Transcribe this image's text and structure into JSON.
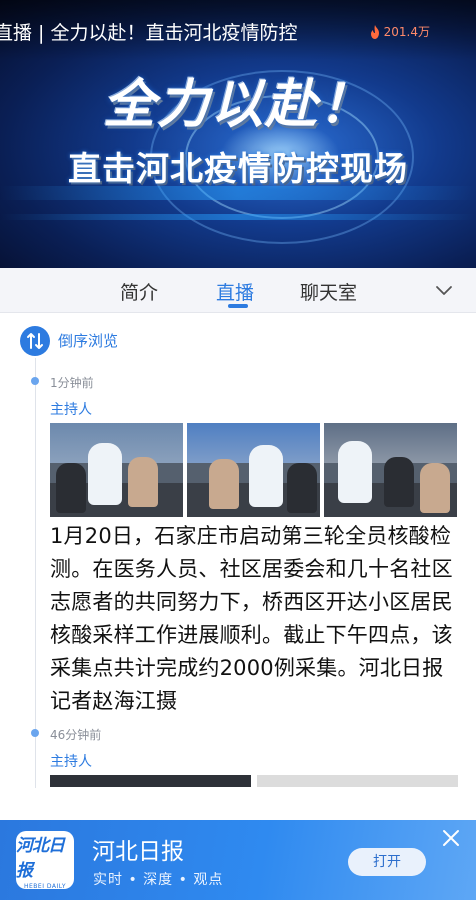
{
  "banner": {
    "live_title": "直播 | 全力以赴！直击河北疫情防控",
    "views": "201.4万",
    "slogan_main": "全力以赴！",
    "slogan_sub": "直击河北疫情防控现场",
    "icons": {
      "views": "fire-icon"
    }
  },
  "tabs": [
    {
      "label": "简介",
      "active": false
    },
    {
      "label": "直播",
      "active": true
    },
    {
      "label": "聊天室",
      "active": false
    }
  ],
  "feed": {
    "order_label": "倒序浏览",
    "posts": [
      {
        "time": "1分钟前",
        "author": "主持人",
        "photo_count": 3,
        "text": "1月20日，石家庄市启动第三轮全员核酸检测。在医务人员、社区居委会和几十名社区志愿者的共同努力下，桥西区开达小区居民核酸采样工作进展顺利。截止下午四点，该采集点共计完成约2000例采集。河北日报记者赵海江摄"
      },
      {
        "time": "46分钟前",
        "author": "主持人",
        "photo_count": 2
      }
    ]
  },
  "ad": {
    "app_name": "河北日报",
    "slogan": "实时 • 深度 • 观点",
    "open_label": "打开",
    "logo_main": "河北日报",
    "logo_sub": "HEBEI DAILY"
  },
  "colors": {
    "accent": "#2d7be0",
    "ad_background": "#2f8af0",
    "timeline_dot": "#6aa5ee"
  }
}
